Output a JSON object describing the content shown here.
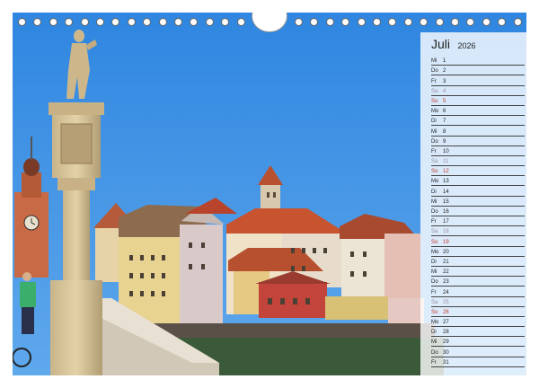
{
  "calendar": {
    "month": "Juli",
    "year": "2026",
    "days": [
      {
        "name": "Mi",
        "date": "1",
        "type": "weekday"
      },
      {
        "name": "Do",
        "date": "2",
        "type": "weekday"
      },
      {
        "name": "Fr",
        "date": "3",
        "type": "weekday"
      },
      {
        "name": "Sa",
        "date": "4",
        "type": "saturday"
      },
      {
        "name": "So",
        "date": "5",
        "type": "sunday"
      },
      {
        "name": "Mo",
        "date": "6",
        "type": "weekday"
      },
      {
        "name": "Di",
        "date": "7",
        "type": "weekday"
      },
      {
        "name": "Mi",
        "date": "8",
        "type": "weekday"
      },
      {
        "name": "Do",
        "date": "9",
        "type": "weekday"
      },
      {
        "name": "Fr",
        "date": "10",
        "type": "weekday"
      },
      {
        "name": "Sa",
        "date": "11",
        "type": "saturday"
      },
      {
        "name": "So",
        "date": "12",
        "type": "sunday"
      },
      {
        "name": "Mo",
        "date": "13",
        "type": "weekday"
      },
      {
        "name": "Di",
        "date": "14",
        "type": "weekday"
      },
      {
        "name": "Mi",
        "date": "15",
        "type": "weekday"
      },
      {
        "name": "Do",
        "date": "16",
        "type": "weekday"
      },
      {
        "name": "Fr",
        "date": "17",
        "type": "weekday"
      },
      {
        "name": "Sa",
        "date": "18",
        "type": "saturday"
      },
      {
        "name": "So",
        "date": "19",
        "type": "sunday"
      },
      {
        "name": "Mo",
        "date": "20",
        "type": "weekday"
      },
      {
        "name": "Di",
        "date": "21",
        "type": "weekday"
      },
      {
        "name": "Mi",
        "date": "22",
        "type": "weekday"
      },
      {
        "name": "Do",
        "date": "23",
        "type": "weekday"
      },
      {
        "name": "Fr",
        "date": "24",
        "type": "weekday"
      },
      {
        "name": "Sa",
        "date": "25",
        "type": "saturday"
      },
      {
        "name": "So",
        "date": "26",
        "type": "sunday"
      },
      {
        "name": "Mo",
        "date": "27",
        "type": "weekday"
      },
      {
        "name": "Di",
        "date": "28",
        "type": "weekday"
      },
      {
        "name": "Mi",
        "date": "29",
        "type": "weekday"
      },
      {
        "name": "Do",
        "date": "30",
        "type": "weekday"
      },
      {
        "name": "Fr",
        "date": "31",
        "type": "weekday"
      }
    ]
  },
  "colors": {
    "sky": "#3d8fe0",
    "sunday": "#c0392b",
    "saturday": "#9a8fa0",
    "water": "#3b5a3a"
  }
}
